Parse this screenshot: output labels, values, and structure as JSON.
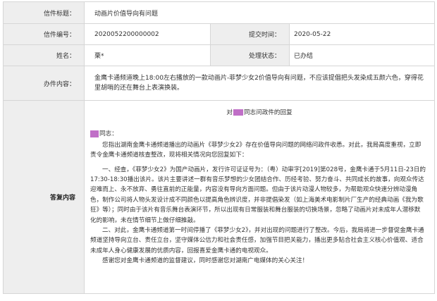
{
  "form": {
    "subject_label": "信件标题：",
    "subject_value": "动画片价值导向有问题",
    "number_label": "信件编号：",
    "number_value": "2020052200000002",
    "submit_time_label": "提交时间：",
    "submit_time_value": "2020-05-22",
    "name_label": "姓名：",
    "name_value": "栗*",
    "status_label": "处理状态：",
    "status_value": "已办结",
    "request_label": "办件内容：",
    "request_value": "金鹰卡通频道晚上18:00左右播放的一款动画片-菲梦少女2价值导向有问题，不应该提倡把头发染成五颜六色，穿得花里胡哨的还在舞台上表演换装。",
    "reply_label": "答复内容"
  },
  "reply": {
    "title_suffix": "同志问政件的回复",
    "salutation_suffix": "同志：",
    "paragraphs": [
      "您指出湖南金鹰卡通频道播出的动画片《菲梦少女2》存在价值导向问题的网络问政件收悉。对此，我局高度重视，立即责令金鹰卡通频道核查整改，现将相关情况向您回复如下：",
      "一、经查，《菲梦少女2》为国产动画片，发行许可证证号为：（粤）动审字[2019]第028号，金鹰卡通于5月11日-23日的17:30-18:30播出该片。该片主要讲述一群有音乐梦想的少女团结合作、历经考验、努力奋斗、共同成长的故事，向观众传达迎难而上、永不放弃、勇往直前的正能量，内容没有导向方面问题。但由于该片动漫人物较多，为帮助观众快速分辨动漫角色，制作公司将人物头发设计成不同颜色以提高角色辨识度，并非提倡染发（如上海美术电影制片厂生产的经典动画《我为歌狂》等）；同时由于该片有音乐舞台表演环节，所以出现有日常服装和舞台服装的切换场景，忽略了动画片对未成年人潜移默化的影响，未在情节细节上做仔细推敲。",
      "二、对此，金鹰卡通频道第一时间停播了《菲梦少女2》，并对出现的问题进行了整改。今后，我局将进一步督促金鹰卡通频道坚持导向立台、责任立台，坚守媒体公信力和社会责任感，加强节目把关能力，播出更多贴合社会主义核心价值观、适合未成年人身心健康发展的优质内容，回报喜爱金鹰卡通的电视观众。",
      "感谢您对金鹰卡通频道的监督建议，同时感谢您对湖南广电媒体的关心关注！"
    ]
  },
  "colors": {
    "label_bg": "#eeeeee",
    "border": "#d6d6d6",
    "redaction": "#c06fc7"
  }
}
